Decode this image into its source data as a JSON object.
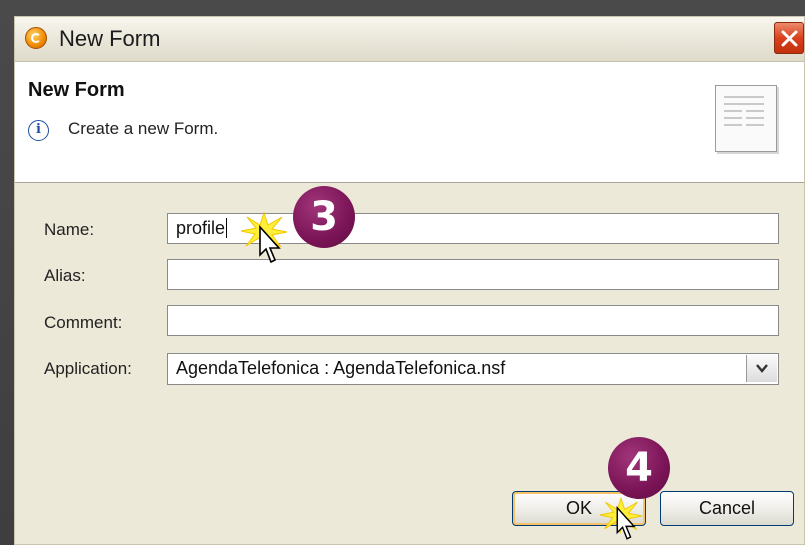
{
  "dialog": {
    "title": "New Form",
    "close_icon": "close-icon"
  },
  "header": {
    "title": "New Form",
    "description": "Create a new Form.",
    "info_icon": "info-icon",
    "info_symbol": "i",
    "form_icon": "form-document-icon"
  },
  "form": {
    "name_label": "Name:",
    "name_value": "profile",
    "alias_label": "Alias:",
    "alias_value": "",
    "comment_label": "Comment:",
    "comment_value": "",
    "application_label": "Application:",
    "application_value": "AgendaTelefonica : AgendaTelefonica.nsf"
  },
  "buttons": {
    "ok_label": "OK",
    "cancel_label": "Cancel"
  },
  "annotations": {
    "step_3": "3",
    "step_4": "4"
  },
  "colors": {
    "step_badge": "#7a1456",
    "close_button": "#d9411c",
    "burst": "#ffef3a"
  }
}
